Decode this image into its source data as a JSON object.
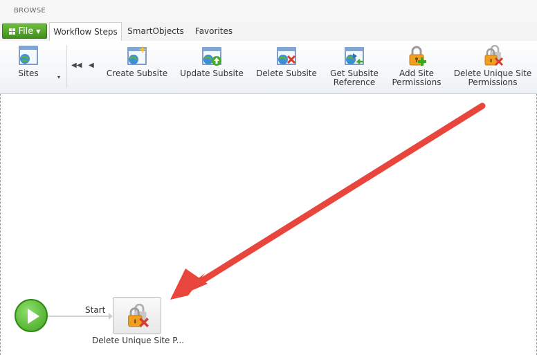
{
  "browse": {
    "label": "BROWSE"
  },
  "file_button": {
    "label": "File"
  },
  "tabs": [
    {
      "label": "Workflow Steps",
      "active": true
    },
    {
      "label": "SmartObjects",
      "active": false
    },
    {
      "label": "Favorites",
      "active": false
    }
  ],
  "ribbon": {
    "sites_label": "Sites",
    "buttons": [
      {
        "label": "Create Subsite",
        "icon": "create-subsite-icon"
      },
      {
        "label": "Update Subsite",
        "icon": "update-subsite-icon"
      },
      {
        "label": "Delete Subsite",
        "icon": "delete-subsite-icon"
      },
      {
        "label1": "Get Subsite",
        "label2": "Reference",
        "icon": "get-subsite-reference-icon"
      },
      {
        "label1": "Add Site",
        "label2": "Permissions",
        "icon": "add-site-permissions-icon"
      },
      {
        "label1": "Delete Unique Site",
        "label2": "Permissions",
        "icon": "delete-unique-site-permissions-icon"
      }
    ]
  },
  "canvas": {
    "start_label": "Start",
    "step_label": "Delete Unique Site P...",
    "annotation_arrow_color": "#e8453c"
  }
}
